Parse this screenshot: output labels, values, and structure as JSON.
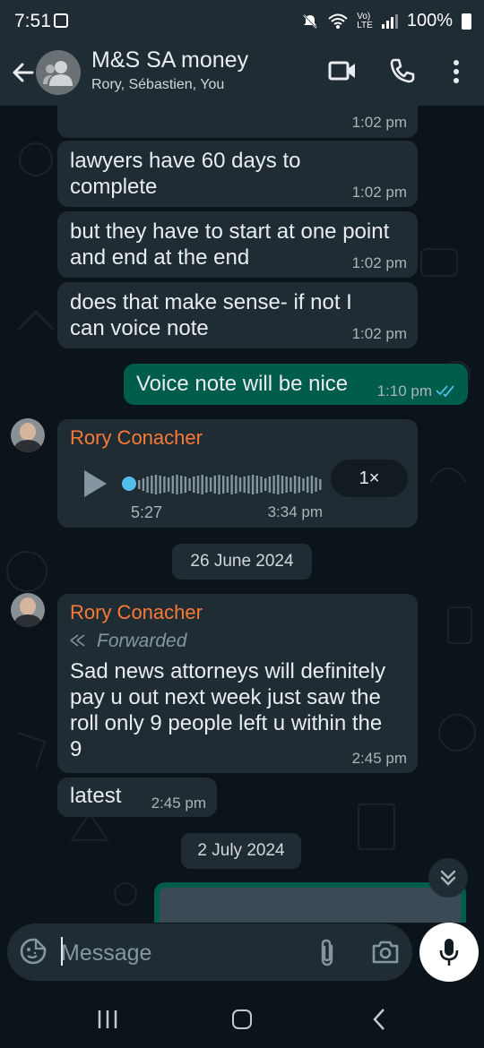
{
  "status": {
    "time": "7:51",
    "battery": "100%",
    "network": "LTE",
    "network_top": "Vo)"
  },
  "header": {
    "title": "M&S SA money",
    "participants": "Rory, Sébastien, You"
  },
  "messages": [
    {
      "type": "in",
      "time": "1:02 pm"
    },
    {
      "type": "in",
      "text": "lawyers have 60 days to\ncomplete",
      "time": "1:02 pm"
    },
    {
      "type": "in",
      "text": "but they have to start at one point\nand end at the end",
      "time": "1:02 pm"
    },
    {
      "type": "in",
      "text": "does that make sense- if not I\ncan voice note",
      "time": "1:02 pm"
    },
    {
      "type": "out",
      "text": "Voice note will be nice",
      "time": "1:10 pm",
      "status": "read"
    },
    {
      "type": "voice",
      "sender": "Rory Conacher",
      "duration": "5:27",
      "time": "3:34 pm",
      "speed": "1×"
    },
    {
      "type": "date",
      "text": "26 June 2024"
    },
    {
      "type": "in",
      "sender": "Rory Conacher",
      "forwarded": "Forwarded",
      "text": "Sad news attorneys will definitely\npay u out next week just saw the\nroll only 9 people left u within the\n9",
      "time": "2:45 pm"
    },
    {
      "type": "in",
      "text": "latest",
      "time": "2:45 pm"
    },
    {
      "type": "date",
      "text": "2 July 2024"
    }
  ],
  "composer": {
    "placeholder": "Message"
  },
  "colors": {
    "accent": "#00a884",
    "outgoing": "#005c4b",
    "incoming": "#1f2c34",
    "sender_name": "#fa7a35",
    "read_ticks": "#53bdeb"
  },
  "icons": [
    "back-arrow-icon",
    "group-icon",
    "video-call-icon",
    "phone-icon",
    "more-vert-icon",
    "play-icon",
    "double-check-icon",
    "forward-icon",
    "chevron-double-down-icon",
    "emoji-icon",
    "attach-icon",
    "camera-icon",
    "mic-icon"
  ]
}
